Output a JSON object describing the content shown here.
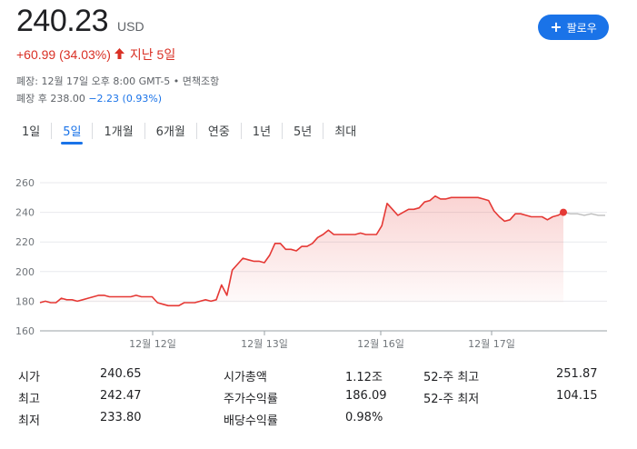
{
  "quote": {
    "price": "240.23",
    "currency": "USD",
    "change": "+60.99 (34.03%)",
    "change_arrow": "up-arrow-icon",
    "period": "지난 5일",
    "close_info": "폐장: 12월 17일 오후 8:00 GMT-5 • 면책조항",
    "after_hours_prefix": "폐장 후 238.00",
    "after_hours_change": "−2.23 (0.93%)"
  },
  "follow_button": {
    "label": "팔로우",
    "icon": "plus-icon"
  },
  "tabs": [
    {
      "label": "1일"
    },
    {
      "label": "5일",
      "active": true
    },
    {
      "label": "1개월"
    },
    {
      "label": "6개월"
    },
    {
      "label": "연중"
    },
    {
      "label": "1년"
    },
    {
      "label": "5년"
    },
    {
      "label": "최대"
    }
  ],
  "chart_data": {
    "type": "line",
    "y_ticks": [
      "260",
      "240",
      "220",
      "200",
      "180",
      "160"
    ],
    "ylim": [
      160,
      260
    ],
    "x_ticks": [
      "12월 12일",
      "12월 13일",
      "12월 16일",
      "12월 17일"
    ],
    "grid": true,
    "colors": {
      "line": "#e53935",
      "fill": "#fce8e6",
      "after_hours": "#bdbdbd",
      "grid": "#e8eaed"
    },
    "series": [
      {
        "values": [
          179,
          180,
          179,
          179,
          182,
          181,
          181,
          180,
          181,
          182,
          183,
          184,
          184,
          183,
          183,
          183,
          183,
          183,
          184,
          183,
          183,
          183,
          179,
          178,
          177,
          177,
          177,
          179,
          179,
          179,
          180,
          181,
          180,
          181,
          191,
          184,
          201,
          205,
          209,
          208,
          207,
          207,
          206,
          211,
          219,
          219,
          215,
          215,
          214,
          217,
          217,
          219,
          223,
          225,
          228,
          225,
          225,
          225,
          225,
          225,
          226,
          225,
          225,
          225,
          231,
          246,
          242,
          238,
          240,
          242,
          242,
          243,
          247,
          248,
          251,
          249,
          249,
          250,
          250,
          250,
          250,
          250,
          250,
          249,
          248,
          241,
          237,
          234,
          235,
          239,
          239,
          238,
          237,
          237,
          237,
          235,
          237,
          238,
          240
        ]
      },
      {
        "values": [
          240,
          239,
          239,
          238,
          239,
          238,
          238
        ]
      }
    ]
  },
  "stats": [
    {
      "label": "시가",
      "value": "240.65"
    },
    {
      "label": "최고",
      "value": "242.47"
    },
    {
      "label": "최저",
      "value": "233.80"
    },
    {
      "label": "시가총액",
      "value": "1.12조"
    },
    {
      "label": "주가수익률",
      "value": "186.09"
    },
    {
      "label": "배당수익률",
      "value": "0.98%"
    },
    {
      "label": "52-주 최고",
      "value": "251.87"
    },
    {
      "label": "52-주 최저",
      "value": "104.15"
    }
  ]
}
